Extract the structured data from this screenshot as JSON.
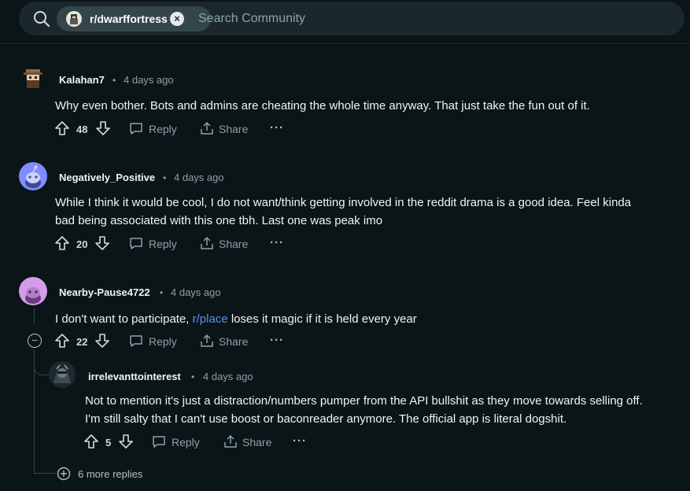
{
  "search": {
    "community": "r/dwarffortress",
    "placeholder": "Search Community"
  },
  "comments": [
    {
      "user": "Kalahan7",
      "time": "4 days ago",
      "text": "Why even bother. Bots and admins are cheating the whole time anyway. That just take the fun out of it.",
      "votes": "48",
      "reply": "Reply",
      "share": "Share",
      "more": "···"
    },
    {
      "user": "Negatively_Positive",
      "time": "4 days ago",
      "text_line1": "While I think it would be cool, I do not want/think getting involved in the reddit drama is a good idea. Feel kinda",
      "text_line2": "bad being associated with this one tbh. Last one was peak imo",
      "votes": "20",
      "reply": "Reply",
      "share": "Share",
      "more": "···"
    },
    {
      "user": "Nearby-Pause4722",
      "time": "4 days ago",
      "text_before": "I don't want to participate, ",
      "link": "r/place",
      "text_after": " loses it magic if it is held every year",
      "votes": "22",
      "reply": "Reply",
      "share": "Share",
      "more": "···"
    },
    {
      "user": "irrelevanttointerest",
      "time": "4 days ago",
      "text_line1": "Not to mention it's just a distraction/numbers pumper from the API bullshit as they move towards selling off.",
      "text_line2": "I'm still salty that I can't use boost or baconreader anymore. The official app is literal dogshit.",
      "votes": "5",
      "reply": "Reply",
      "share": "Share",
      "more": "···"
    }
  ],
  "more_replies": "6 more replies",
  "dot": "•",
  "collapse_symbol": "−",
  "chip_close": "×"
}
